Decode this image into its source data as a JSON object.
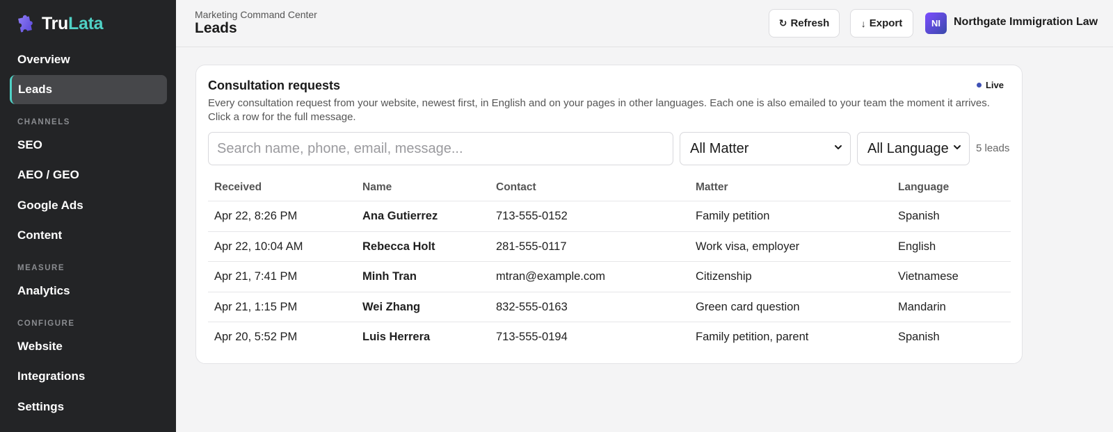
{
  "app": {
    "brand_part1": "Tru",
    "brand_part2": "Lata",
    "brand_color": "#4fd1c5",
    "logo_icon": "puzzle-icon"
  },
  "sidebar": {
    "items": [
      {
        "label": "Overview",
        "active": false
      },
      {
        "label": "Leads",
        "active": true
      }
    ],
    "channels_label": "CHANNELS",
    "channels": [
      {
        "label": "SEO"
      },
      {
        "label": "AEO / GEO"
      },
      {
        "label": "Google Ads"
      },
      {
        "label": "Content"
      }
    ],
    "measure_label": "MEASURE",
    "measure": [
      {
        "label": "Analytics"
      }
    ],
    "configure_label": "CONFIGURE",
    "configure": [
      {
        "label": "Website"
      },
      {
        "label": "Integrations"
      },
      {
        "label": "Settings"
      }
    ]
  },
  "header": {
    "subtitle": "Marketing Command Center",
    "title": "Leads",
    "refresh_label": "Refresh",
    "export_label": "Export",
    "org_initials": "NI",
    "org_name": "Northgate Immigration Law"
  },
  "card": {
    "title": "Consultation requests",
    "live_label": "Live",
    "description": "Every consultation request from your website, newest first, in English and on your pages in other languages. Each one is also emailed to your team the moment it arrives. Click a row for the full message.",
    "search_placeholder": "Search name, phone, email, message...",
    "matter_filter": "All Matter",
    "language_filter": "All Language",
    "lead_count": "5 leads"
  },
  "table": {
    "columns": [
      "Received",
      "Name",
      "Contact",
      "Matter",
      "Language"
    ],
    "rows": [
      {
        "received": "Apr 22, 8:26 PM",
        "name": "Ana Gutierrez",
        "contact": "713-555-0152",
        "matter": "Family petition",
        "language": "Spanish"
      },
      {
        "received": "Apr 22, 10:04 AM",
        "name": "Rebecca Holt",
        "contact": "281-555-0117",
        "matter": "Work visa, employer",
        "language": "English"
      },
      {
        "received": "Apr 21, 7:41 PM",
        "name": "Minh Tran",
        "contact": "mtran@example.com",
        "matter": "Citizenship",
        "language": "Vietnamese"
      },
      {
        "received": "Apr 21, 1:15 PM",
        "name": "Wei Zhang",
        "contact": "832-555-0163",
        "matter": "Green card question",
        "language": "Mandarin"
      },
      {
        "received": "Apr 20, 5:52 PM",
        "name": "Luis Herrera",
        "contact": "713-555-0194",
        "matter": "Family petition, parent",
        "language": "Spanish"
      }
    ]
  }
}
